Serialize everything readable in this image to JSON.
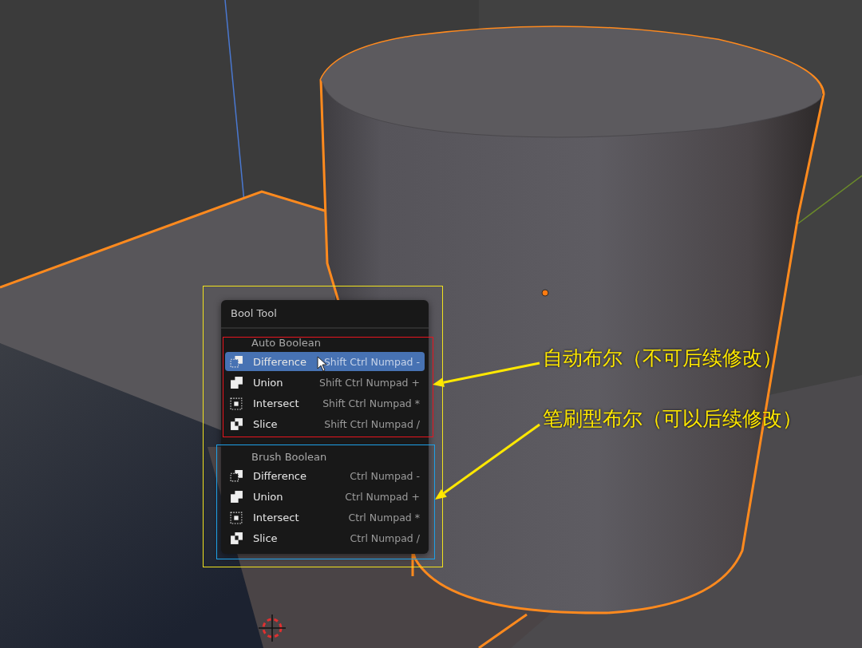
{
  "menu": {
    "title": "Bool Tool",
    "sections": [
      {
        "label": "Auto Boolean",
        "items": [
          {
            "kind": "difference",
            "label": "Difference",
            "shortcut": "Shift Ctrl Numpad -",
            "selected": true
          },
          {
            "kind": "union",
            "label": "Union",
            "shortcut": "Shift Ctrl Numpad +",
            "selected": false
          },
          {
            "kind": "intersect",
            "label": "Intersect",
            "shortcut": "Shift Ctrl Numpad *",
            "selected": false
          },
          {
            "kind": "slice",
            "label": "Slice",
            "shortcut": "Shift Ctrl Numpad /",
            "selected": false
          }
        ]
      },
      {
        "label": "Brush Boolean",
        "items": [
          {
            "kind": "difference",
            "label": "Difference",
            "shortcut": "Ctrl Numpad -",
            "selected": false
          },
          {
            "kind": "union",
            "label": "Union",
            "shortcut": "Ctrl Numpad +",
            "selected": false
          },
          {
            "kind": "intersect",
            "label": "Intersect",
            "shortcut": "Ctrl Numpad *",
            "selected": false
          },
          {
            "kind": "slice",
            "label": "Slice",
            "shortcut": "Ctrl Numpad /",
            "selected": false
          }
        ]
      }
    ]
  },
  "frames": [
    {
      "color": "#f0e21e"
    },
    {
      "color": "#e8141e"
    },
    {
      "color": "#1ea0e6"
    }
  ],
  "callouts": [
    {
      "text": "自动布尔（不可后续修改）"
    },
    {
      "text": "笔刷型布尔（可以后续修改）"
    }
  ]
}
